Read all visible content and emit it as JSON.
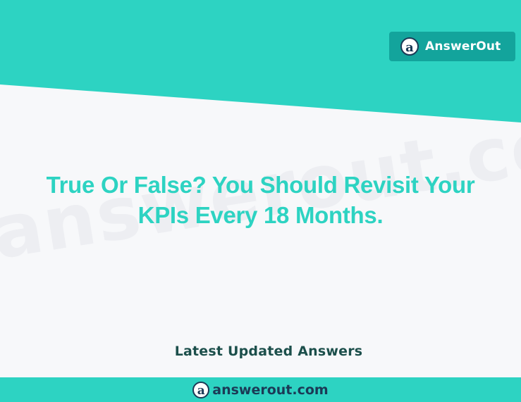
{
  "brand": {
    "logo_glyph": "a",
    "name": "AnswerOut"
  },
  "watermark": {
    "text": "answerout.com"
  },
  "question": {
    "line1": "True Or False? You Should Revisit Your",
    "line2": "KPIs Every 18 Months."
  },
  "section": {
    "latest_label": "Latest Updated Answers"
  },
  "footer": {
    "logo_glyph": "a",
    "site": "answerout.com"
  },
  "colors": {
    "teal": "#2dd3c2",
    "badge": "#13a49c",
    "navy": "#1b3a56",
    "background": "#f7f8fa"
  }
}
